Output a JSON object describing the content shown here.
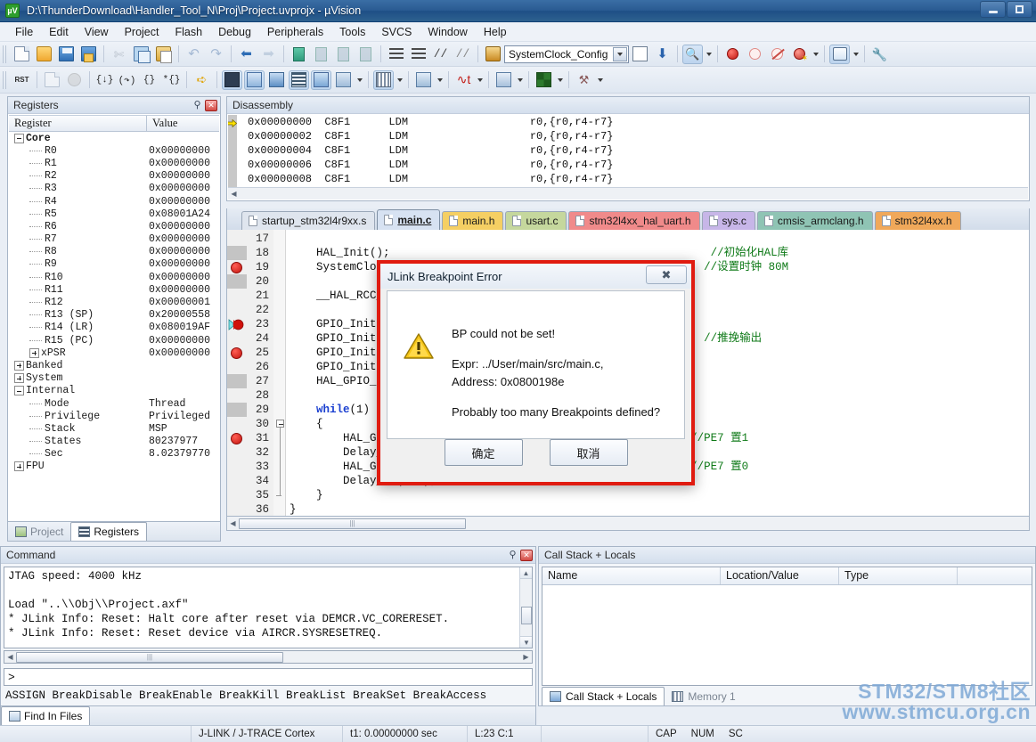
{
  "window": {
    "title": "D:\\ThunderDownload\\Handler_Tool_N\\Proj\\Project.uvprojx - µVision",
    "app_icon": "uvision-icon",
    "minimize": "minimize-button",
    "maximize": "maximize-button"
  },
  "menu": [
    "File",
    "Edit",
    "View",
    "Project",
    "Flash",
    "Debug",
    "Peripherals",
    "Tools",
    "SVCS",
    "Window",
    "Help"
  ],
  "toolbar": {
    "function_combo_value": "SystemClock_Config",
    "icons_row1": [
      "new-file-icon",
      "open-file-icon",
      "save-icon",
      "save-all-icon",
      "cut-icon",
      "copy-icon",
      "paste-icon",
      "undo-icon",
      "redo-icon",
      "back-icon",
      "forward-icon",
      "bookmark-toggle-icon",
      "bookmark-prev-icon",
      "bookmark-next-icon",
      "bookmark-clear-icon",
      "indent-icon",
      "outdent-icon",
      "comment-icon",
      "uncomment-icon",
      "find-in-files-icon"
    ],
    "icons_row2": [
      "reset-icon",
      "step-out-list-icon",
      "stop-icon",
      "step-icon",
      "step-over-icon",
      "step-out-icon",
      "run-to-cursor-icon",
      "show-statement-icon",
      "command-window-icon",
      "disassembly-window-icon",
      "symbols-window-icon",
      "registers-window-icon",
      "call-stack-icon",
      "watch-window-icon",
      "memory-window-icon",
      "serial-window-icon",
      "analysis-icon",
      "trace-icon",
      "system-viewer-icon",
      "tools-icon"
    ],
    "debug_icons": [
      "bookmark-icon",
      "insert-bookmark-icon",
      "breakpoint-insert-icon",
      "breakpoint-disable-icon",
      "breakpoint-kill-all-icon",
      "breakpoint-disable-all-icon",
      "manage-components-icon",
      "configure-icon"
    ]
  },
  "registers": {
    "title": "Registers",
    "columns": [
      "Register",
      "Value"
    ],
    "rows": [
      {
        "name": "Core",
        "value": "",
        "level": 0,
        "twisty": "minus",
        "bold": true
      },
      {
        "name": "R0",
        "value": "0x00000000",
        "level": 1
      },
      {
        "name": "R1",
        "value": "0x00000000",
        "level": 1
      },
      {
        "name": "R2",
        "value": "0x00000000",
        "level": 1
      },
      {
        "name": "R3",
        "value": "0x00000000",
        "level": 1
      },
      {
        "name": "R4",
        "value": "0x00000000",
        "level": 1
      },
      {
        "name": "R5",
        "value": "0x08001A24",
        "level": 1
      },
      {
        "name": "R6",
        "value": "0x00000000",
        "level": 1
      },
      {
        "name": "R7",
        "value": "0x00000000",
        "level": 1
      },
      {
        "name": "R8",
        "value": "0x00000000",
        "level": 1
      },
      {
        "name": "R9",
        "value": "0x00000000",
        "level": 1
      },
      {
        "name": "R10",
        "value": "0x00000000",
        "level": 1
      },
      {
        "name": "R11",
        "value": "0x00000000",
        "level": 1
      },
      {
        "name": "R12",
        "value": "0x00000001",
        "level": 1
      },
      {
        "name": "R13 (SP)",
        "value": "0x20000558",
        "level": 1
      },
      {
        "name": "R14 (LR)",
        "value": "0x080019AF",
        "level": 1
      },
      {
        "name": "R15 (PC)",
        "value": "0x00000000",
        "level": 1
      },
      {
        "name": "xPSR",
        "value": "0x00000000",
        "level": 1,
        "twisty": "plus"
      },
      {
        "name": "Banked",
        "value": "",
        "level": 0,
        "twisty": "plus"
      },
      {
        "name": "System",
        "value": "",
        "level": 0,
        "twisty": "plus"
      },
      {
        "name": "Internal",
        "value": "",
        "level": 0,
        "twisty": "minus"
      },
      {
        "name": "Mode",
        "value": "Thread",
        "level": 1
      },
      {
        "name": "Privilege",
        "value": "Privileged",
        "level": 1
      },
      {
        "name": "Stack",
        "value": "MSP",
        "level": 1
      },
      {
        "name": "States",
        "value": "80237977",
        "level": 1
      },
      {
        "name": "Sec",
        "value": "8.02379770",
        "level": 1
      },
      {
        "name": "FPU",
        "value": "",
        "level": 0,
        "twisty": "plus"
      }
    ],
    "bottom_tabs": [
      {
        "label": "Project",
        "active": false,
        "icon": "project-icon"
      },
      {
        "label": "Registers",
        "active": true,
        "icon": "registers-icon"
      }
    ]
  },
  "disassembly": {
    "title": "Disassembly",
    "lines": [
      {
        "addr": "0x00000000",
        "code": "C8F1",
        "mnem": "LDM",
        "ops": "r0,{r0,r4-r7}",
        "current": true
      },
      {
        "addr": "0x00000002",
        "code": "C8F1",
        "mnem": "LDM",
        "ops": "r0,{r0,r4-r7}",
        "current": false
      },
      {
        "addr": "0x00000004",
        "code": "C8F1",
        "mnem": "LDM",
        "ops": "r0,{r0,r4-r7}",
        "current": false
      },
      {
        "addr": "0x00000006",
        "code": "C8F1",
        "mnem": "LDM",
        "ops": "r0,{r0,r4-r7}",
        "current": false
      },
      {
        "addr": "0x00000008",
        "code": "C8F1",
        "mnem": "LDM",
        "ops": "r0,{r0,r4-r7}",
        "current": false
      }
    ]
  },
  "editor_tabs": [
    {
      "label": "startup_stm32l4r9xx.s",
      "color": "#dfe5ee",
      "active": false
    },
    {
      "label": "main.c",
      "color": "#d7e2f2",
      "active": true
    },
    {
      "label": "main.h",
      "color": "#f5cf63",
      "active": false
    },
    {
      "label": "usart.c",
      "color": "#c5d79d",
      "active": false
    },
    {
      "label": "stm32l4xx_hal_uart.h",
      "color": "#f08a8a",
      "active": false
    },
    {
      "label": "sys.c",
      "color": "#c7b6e8",
      "active": false
    },
    {
      "label": "cmsis_armclang.h",
      "color": "#8fc4b4",
      "active": false
    },
    {
      "label": "stm32l4xx.h",
      "color": "#f0a85a",
      "active": false
    }
  ],
  "code": {
    "first_line": 17,
    "lines": [
      {
        "n": 17,
        "text": "",
        "bp": false,
        "shade": false
      },
      {
        "n": 18,
        "text": "    HAL_Init();                                                //初始化HAL库",
        "bp": false,
        "shade": true
      },
      {
        "n": 19,
        "text": "    SystemClock_Config();                                     //设置时钟 80M",
        "bp": true,
        "shade": false
      },
      {
        "n": 20,
        "text": "",
        "bp": false,
        "shade": true
      },
      {
        "n": 21,
        "text": "    __HAL_RCC_GPIOE_CLK_ENABLE();",
        "bp": false,
        "shade": false
      },
      {
        "n": 22,
        "text": "",
        "bp": false,
        "shade": false
      },
      {
        "n": 23,
        "text": "    GPIO_InitStruct.Pin = GPIO_PIN_7;",
        "bp": false,
        "shade": false,
        "cursor": true
      },
      {
        "n": 24,
        "text": "    GPIO_InitStruct.Mode = GPIO_MODE_OUTPUT_PP;               //推挽输出",
        "bp": false,
        "shade": false
      },
      {
        "n": 25,
        "text": "    GPIO_InitStruct.Pull = GPIO_PULLUP;",
        "bp": true,
        "shade": false
      },
      {
        "n": 26,
        "text": "    GPIO_InitStruct.Speed = GPIO_SPEED_FREQ_HIGH;",
        "bp": false,
        "shade": false
      },
      {
        "n": 27,
        "text": "    HAL_GPIO_Init(GPIOE, &GPIO_InitStruct);",
        "bp": false,
        "shade": true
      },
      {
        "n": 28,
        "text": "",
        "bp": false,
        "shade": false
      },
      {
        "n": 29,
        "text": "    while(1)",
        "bp": false,
        "shade": true,
        "kw": "while"
      },
      {
        "n": 30,
        "text": "    {",
        "bp": false,
        "shade": false,
        "fold": true
      },
      {
        "n": 31,
        "text": "        HAL_GPIO_WritePin(GPIOE,GPIO_PIN_7,GPIO_PIN_SET);   //PE7 置1",
        "bp": true,
        "shade": false
      },
      {
        "n": 32,
        "text": "        Delay_ms(500);",
        "bp": false,
        "shade": false
      },
      {
        "n": 33,
        "text": "        HAL_GPIO_WritePin(GPIOE,GPIO_PIN_7,GPIO_PIN_RESET); //PE7 置0",
        "bp": false,
        "shade": false
      },
      {
        "n": 34,
        "text": "        Delay_ms(500);",
        "bp": false,
        "shade": false
      },
      {
        "n": 35,
        "text": "    }",
        "bp": false,
        "shade": false,
        "foldend": true
      },
      {
        "n": 36,
        "text": "}",
        "bp": false,
        "shade": false
      }
    ]
  },
  "dialog": {
    "title": "JLink Breakpoint Error",
    "close_label": "✖",
    "icon": "warning-icon",
    "message_1": "BP could not be set!",
    "message_2a": "Expr: ../User/main/src/main.c,",
    "message_2b": "Address: 0x0800198e",
    "message_3": "Probably too many Breakpoints defined?",
    "ok_label": "确定",
    "cancel_label": "取消"
  },
  "command": {
    "title": "Command",
    "output": [
      "JTAG speed: 4000 kHz",
      "",
      "Load \"..\\\\Obj\\\\Project.axf\"",
      "* JLink Info: Reset: Halt core after reset via DEMCR.VC_CORERESET.",
      "* JLink Info: Reset: Reset device via AIRCR.SYSRESETREQ."
    ],
    "prompt": ">",
    "hint": "ASSIGN BreakDisable BreakEnable BreakKill BreakList BreakSet BreakAccess",
    "tabs": [
      {
        "label": "Find In Files",
        "active": true,
        "icon": "find-in-files-icon"
      }
    ]
  },
  "callstack": {
    "title": "Call Stack + Locals",
    "columns": [
      "Name",
      "Location/Value",
      "Type"
    ],
    "rows": [],
    "tabs": [
      {
        "label": "Call Stack + Locals",
        "active": true,
        "icon": "call-stack-icon"
      },
      {
        "label": "Memory 1",
        "active": false,
        "icon": "memory-icon"
      }
    ]
  },
  "watermark": {
    "line1": "STM32/STM8社区",
    "line2": "www.stmcu.org.cn"
  },
  "statusbar": {
    "debugger": "J-LINK / J-TRACE Cortex",
    "time": "t1: 0.00000000 sec",
    "position": "L:23 C:1",
    "caps": "CAP",
    "num": "NUM",
    "scroll": "SC"
  },
  "colors": {
    "accent": "#2a5b92",
    "error_border": "#e01b10",
    "breakpoint": "#c4150f",
    "comment": "#0f7a18",
    "keyword": "#1a3fd0",
    "watermark": "#7fa9d6"
  }
}
